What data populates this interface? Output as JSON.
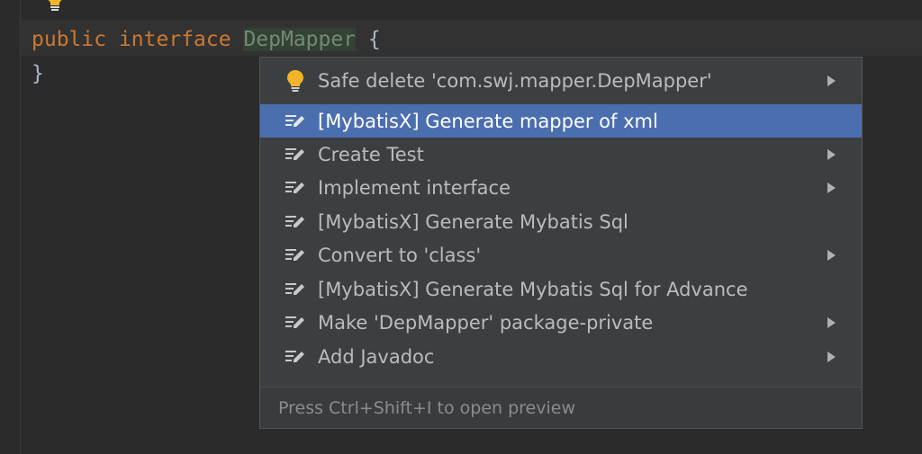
{
  "editor": {
    "line1": {
      "keyword_public": "public",
      "keyword_interface": "interface",
      "identifier": "DepMapper",
      "open_brace": "{"
    },
    "line2": {
      "close_brace": "}"
    }
  },
  "popup": {
    "items": [
      {
        "label": "Safe delete 'com.swj.mapper.DepMapper'",
        "icon": "lightbulb-icon",
        "has_submenu": true,
        "selected": false
      },
      {
        "label": "[MybatisX] Generate mapper of xml",
        "icon": "intention-edit-icon",
        "has_submenu": false,
        "selected": true
      },
      {
        "label": "Create Test",
        "icon": "intention-edit-icon",
        "has_submenu": true,
        "selected": false
      },
      {
        "label": "Implement interface",
        "icon": "intention-edit-icon",
        "has_submenu": true,
        "selected": false
      },
      {
        "label": "[MybatisX] Generate Mybatis Sql",
        "icon": "intention-edit-icon",
        "has_submenu": false,
        "selected": false
      },
      {
        "label": "Convert to 'class'",
        "icon": "intention-edit-icon",
        "has_submenu": true,
        "selected": false
      },
      {
        "label": "[MybatisX] Generate Mybatis Sql for Advance",
        "icon": "intention-edit-icon",
        "has_submenu": false,
        "selected": false
      },
      {
        "label": "Make 'DepMapper' package-private",
        "icon": "intention-edit-icon",
        "has_submenu": true,
        "selected": false
      },
      {
        "label": "Add Javadoc",
        "icon": "intention-edit-icon",
        "has_submenu": true,
        "selected": false
      }
    ],
    "footer_hint": "Press Ctrl+Shift+I to open preview"
  },
  "colors": {
    "editor_bg": "#2b2b2b",
    "keyword": "#cc7832",
    "selection": "#4b6eaf",
    "bulb": "#f4b42a"
  }
}
